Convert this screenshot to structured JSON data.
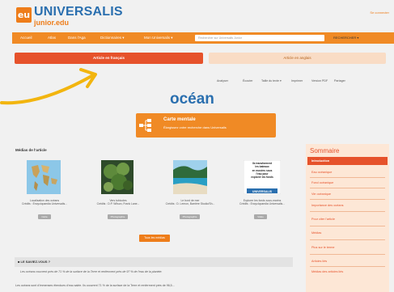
{
  "header": {
    "logo_badge": "eu",
    "brand": "UNIVERSALIS",
    "brand_sub": "junior.edu",
    "connect": "Se connecter"
  },
  "nav": {
    "items": [
      "Accueil",
      "Atlas",
      "Dans l'Aga",
      "Dictionnaires ▾",
      "Mon Universalis ▾"
    ],
    "search_placeholder": "Rechercher sur Universalis Junior",
    "right": "RECHERCHER ▾"
  },
  "tabs": {
    "fr": "Article en français",
    "en": "Article en anglais"
  },
  "tools": [
    "Analyser",
    "Écouter",
    "Taille du texte ▾",
    "Imprimer",
    "Version PDF",
    "Partager"
  ],
  "article": {
    "title": "océan"
  },
  "carte": {
    "title": "Carte mentale",
    "subtitle": "Élargissez votre recherche dans Universalis"
  },
  "media": {
    "label": "Médias de l'article",
    "items": [
      {
        "caption1": "Localisation des océans",
        "caption2": "Crédits : Encyclopaedia Universalis...",
        "btn": "Carte"
      },
      {
        "caption1": "Vers tubicoles",
        "caption2": "Crédits : D.P. Wilson, Frank Lane...",
        "btn": "Photographie"
      },
      {
        "caption1": "Le bord de mer",
        "caption2": "Crédits : D. Lemon, Barrière Studio/Sh...",
        "btn": "Photographie"
      },
      {
        "caption1": "Explorer les fonds sous-marins",
        "caption2": "Crédits : Encyclopaedia Universalis...",
        "btn": "Vidéo"
      }
    ],
    "video_text": [
      "Ils transforment",
      "les bateaux",
      "en musées sous",
      "l'eau pour",
      "explorer les fonds",
      "UNIVERSALIS"
    ],
    "all_button": "Tous les médias"
  },
  "saviez": {
    "title": "LE SAVIEZ-VOUS ?",
    "text": "Les océans couvrent près de 71 % de la surface de la Terre et renferment près de 97 % de l'eau de la planète.",
    "bottom": "Les océans sont d'immenses étendues d'eau salée. Ils couvrent 71 % de la surface de la Terre et renferment près de 96,5..."
  },
  "sommaire": {
    "title": "Sommaire",
    "items": [
      "Introduction",
      "Eau océanique",
      "Fond océanique",
      "Vie océanique",
      "Importance des océans",
      "Pour citer l'article",
      "Médias",
      "Plus sur le terme",
      "Articles liés",
      "Médias des articles liés"
    ]
  },
  "colors": {
    "orange": "#f08a25",
    "red_orange": "#e6522b",
    "blue": "#2a6faf",
    "arrow": "#f2b50f"
  }
}
